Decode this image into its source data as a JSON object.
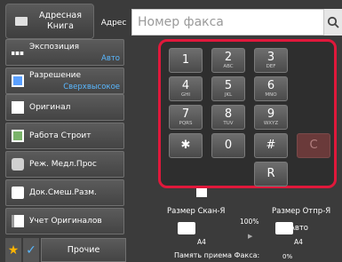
{
  "header": {
    "address_book_label": "Адресная\nКнига",
    "address_label": "Адрес",
    "fax_placeholder": "Номер факса"
  },
  "menu": [
    {
      "label": "Экспозиция",
      "value": "Авто",
      "icon": "exposure-icon"
    },
    {
      "label": "Разрешение",
      "value": "Сверхвысокое",
      "icon": "resolution-icon"
    },
    {
      "label": "Оригинал",
      "value": "",
      "icon": "original-icon"
    },
    {
      "label": "Работа Строит",
      "value": "",
      "icon": "job-build-icon"
    },
    {
      "label": "Реж. Медл.Прос",
      "value": "",
      "icon": "slow-scan-icon"
    },
    {
      "label": "Док.Смеш.Разм.",
      "value": "",
      "icon": "mixed-size-icon"
    },
    {
      "label": "Учет Оригиналов",
      "value": "",
      "icon": "original-count-icon"
    }
  ],
  "bottom": {
    "other_label": "Прочие",
    "favorite_icon": "star-icon",
    "check_icon": "check-icon"
  },
  "keypad": {
    "keys": [
      {
        "d": "1",
        "s": ""
      },
      {
        "d": "2",
        "s": "ABC"
      },
      {
        "d": "3",
        "s": "DEF"
      },
      {
        "d": "4",
        "s": "GHI"
      },
      {
        "d": "5",
        "s": "JKL"
      },
      {
        "d": "6",
        "s": "MNO"
      },
      {
        "d": "7",
        "s": "PQRS"
      },
      {
        "d": "8",
        "s": "TUV"
      },
      {
        "d": "9",
        "s": "WXYZ"
      },
      {
        "d": "✱",
        "s": ""
      },
      {
        "d": "0",
        "s": ""
      },
      {
        "d": "#",
        "s": ""
      },
      {
        "d": "C",
        "s": ""
      },
      {
        "d": "R",
        "s": ""
      }
    ]
  },
  "info": {
    "scan_size_label": "Размер Скан-Я",
    "send_size_label": "Размер Отпр-Я",
    "ratio": "100%",
    "auto": "Авто",
    "scan_paper": "A4",
    "send_paper": "A4",
    "memory_label": "Память приема Факса:",
    "memory_value": "0%"
  },
  "colors": {
    "accent": "#e0183b",
    "value_blue": "#5ab8ff"
  }
}
